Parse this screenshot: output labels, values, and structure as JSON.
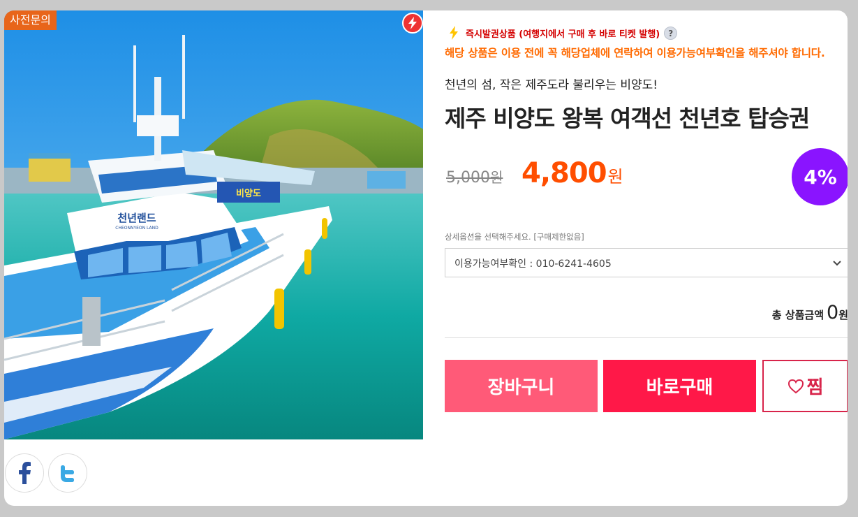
{
  "product": {
    "pre_inquiry_badge": "사전문의",
    "instant_issue_text": "즉시발권상품 (여행지에서 구매 후 바로 티켓 발행)",
    "help_mark": "?",
    "notice": "해당 상품은 이용 전에 꼭 해당업체에 연락하여 이용가능여부확인을 해주셔야 합니다.",
    "subtitle": "천년의 섬, 작은 제주도라 불리우는 비양도!",
    "title": "제주 비양도 왕복 여객선 천년호 탑승권",
    "original_price": "5,000",
    "original_price_unit": "원",
    "sale_price": "4,800",
    "sale_price_unit": "원",
    "discount": "4%"
  },
  "photo": {
    "ship_sign": "천년랜드",
    "ship_sign_sub": "CHEONNYEON LAND",
    "ship_banner": "비양도"
  },
  "options": {
    "label": "상세옵션을 선택해주세요. [구매제한없음]",
    "selected": "이용가능여부확인 : 010-6241-4605"
  },
  "total": {
    "label": "총 상품금액",
    "amount": "0",
    "unit": "원"
  },
  "buttons": {
    "cart": "장바구니",
    "buy": "바로구매",
    "wish": "찜"
  },
  "share": {
    "facebook": "f"
  },
  "colors": {
    "sale": "#ff4e00",
    "discount_badge": "#8a14ff",
    "cart_button": "#ff5a78",
    "buy_button": "#ff1848",
    "notice": "#ff6a00"
  }
}
